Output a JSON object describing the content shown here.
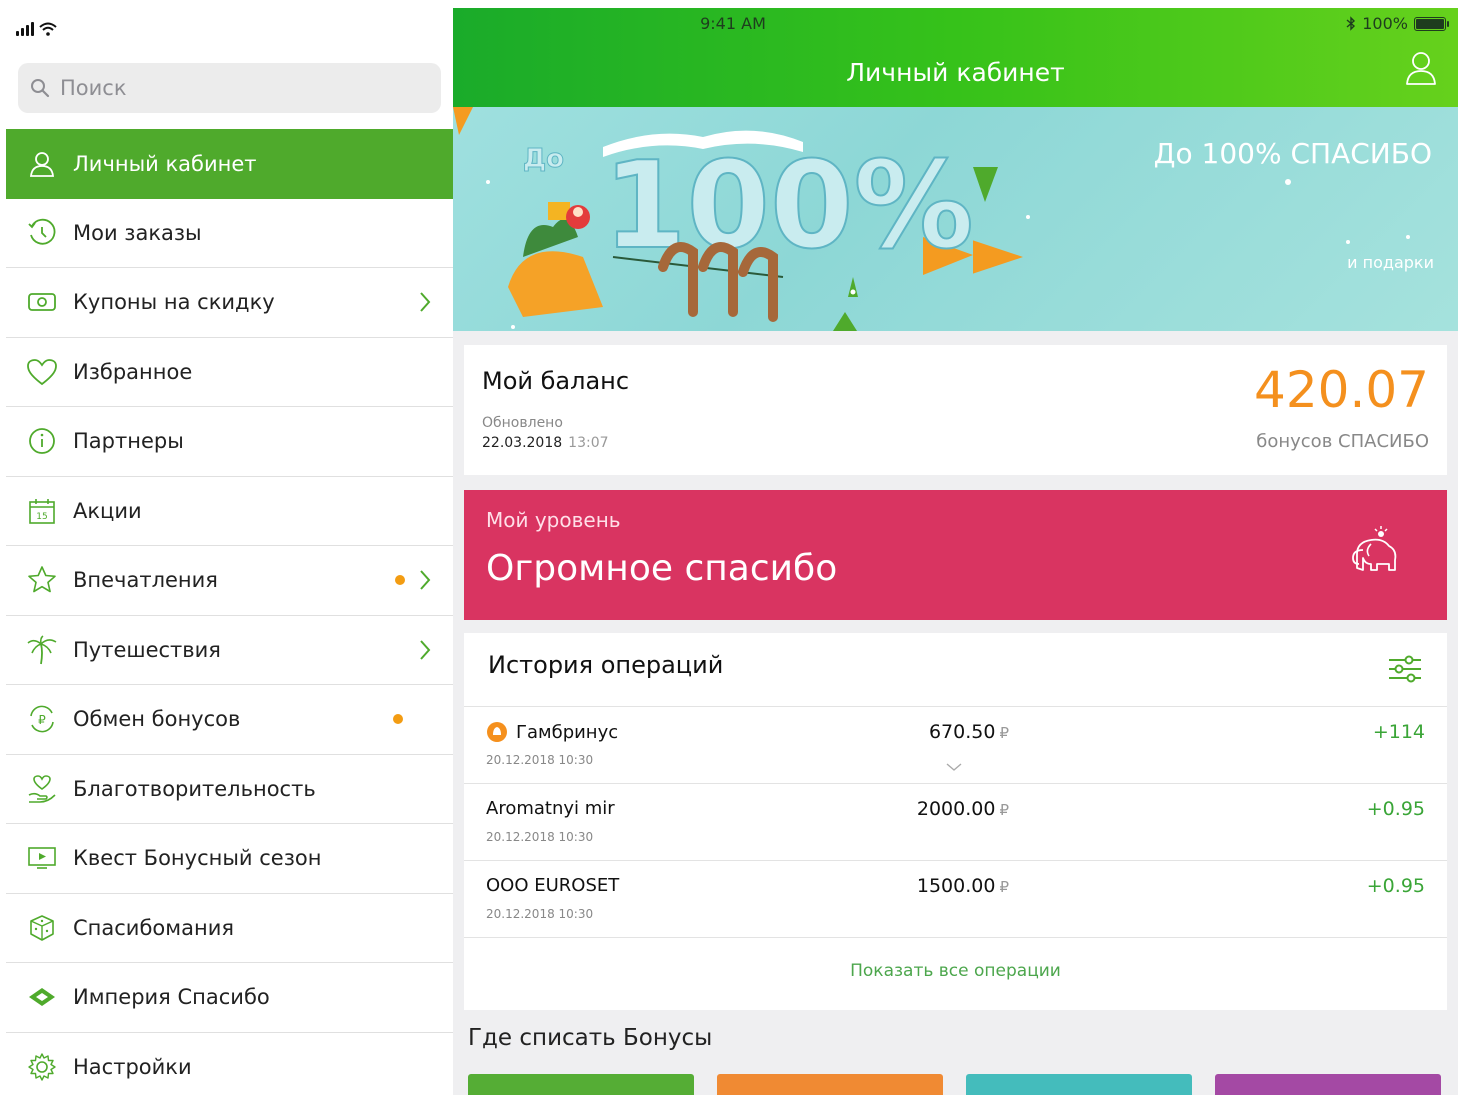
{
  "status": {
    "time": "9:41 AM",
    "battery": "100%"
  },
  "sidebar": {
    "search": {
      "placeholder": "Поиск",
      "value": ""
    },
    "items": [
      {
        "label": "Личный кабинет",
        "icon": "user-icon",
        "active": true
      },
      {
        "label": "Мои заказы",
        "icon": "history-icon"
      },
      {
        "label": "Купоны на скидку",
        "icon": "coupon-icon",
        "chevron": true
      },
      {
        "label": "Избранное",
        "icon": "heart-icon"
      },
      {
        "label": "Партнеры",
        "icon": "info-icon"
      },
      {
        "label": "Акции",
        "icon": "calendar-icon"
      },
      {
        "label": "Впечатления",
        "icon": "star-icon",
        "chevron": true,
        "dot": true
      },
      {
        "label": "Путешествия",
        "icon": "palm-icon",
        "chevron": true
      },
      {
        "label": "Обмен бонусов",
        "icon": "ruble-exchange-icon",
        "dot": true
      },
      {
        "label": "Благотворительность",
        "icon": "charity-icon"
      },
      {
        "label": "Квест Бонусный сезон",
        "icon": "play-screen-icon"
      },
      {
        "label": "Спасибомания",
        "icon": "dice-icon"
      },
      {
        "label": "Империя Спасибо",
        "icon": "diamond-icon"
      },
      {
        "label": "Настройки",
        "icon": "gear-icon"
      }
    ]
  },
  "header": {
    "title": "Личный кабинет"
  },
  "banner": {
    "title": "До 100% СПАСИБО",
    "subtitle": "и подарки",
    "art_text": "До 100%"
  },
  "balance": {
    "title": "Мой баланс",
    "updated_label": "Обновлено",
    "updated_date": "22.03.2018",
    "updated_time": "13:07",
    "amount": "420.07",
    "unit": "бонусов СПАСИБО"
  },
  "level": {
    "label": "Мой уровень",
    "name": "Огромное спасибо"
  },
  "history": {
    "title": "История операций",
    "operations": [
      {
        "name": "Гамбринус",
        "date": "20.12.2018 10:30",
        "amount": "670.50",
        "currency": "₽",
        "bonus": "+114"
      },
      {
        "name": "Aromatnyi mir",
        "date": "20.12.2018 10:30",
        "amount": "2000.00",
        "currency": "₽",
        "bonus": "+0.95"
      },
      {
        "name": "OOO EUROSET",
        "date": "20.12.2018 10:30",
        "amount": "1500.00",
        "currency": "₽",
        "bonus": "+0.95"
      }
    ],
    "show_all": "Показать все операции"
  },
  "where": {
    "title": "Где списать Бонусы"
  },
  "colors": {
    "accent": "#4faa2c",
    "level": "#d93461",
    "amount": "#f4901e",
    "bonus": "#3aa537",
    "dot": "#f39c12",
    "tiles": [
      "#55ad35",
      "#f08a33",
      "#44bcbc",
      "#a449a4"
    ]
  }
}
